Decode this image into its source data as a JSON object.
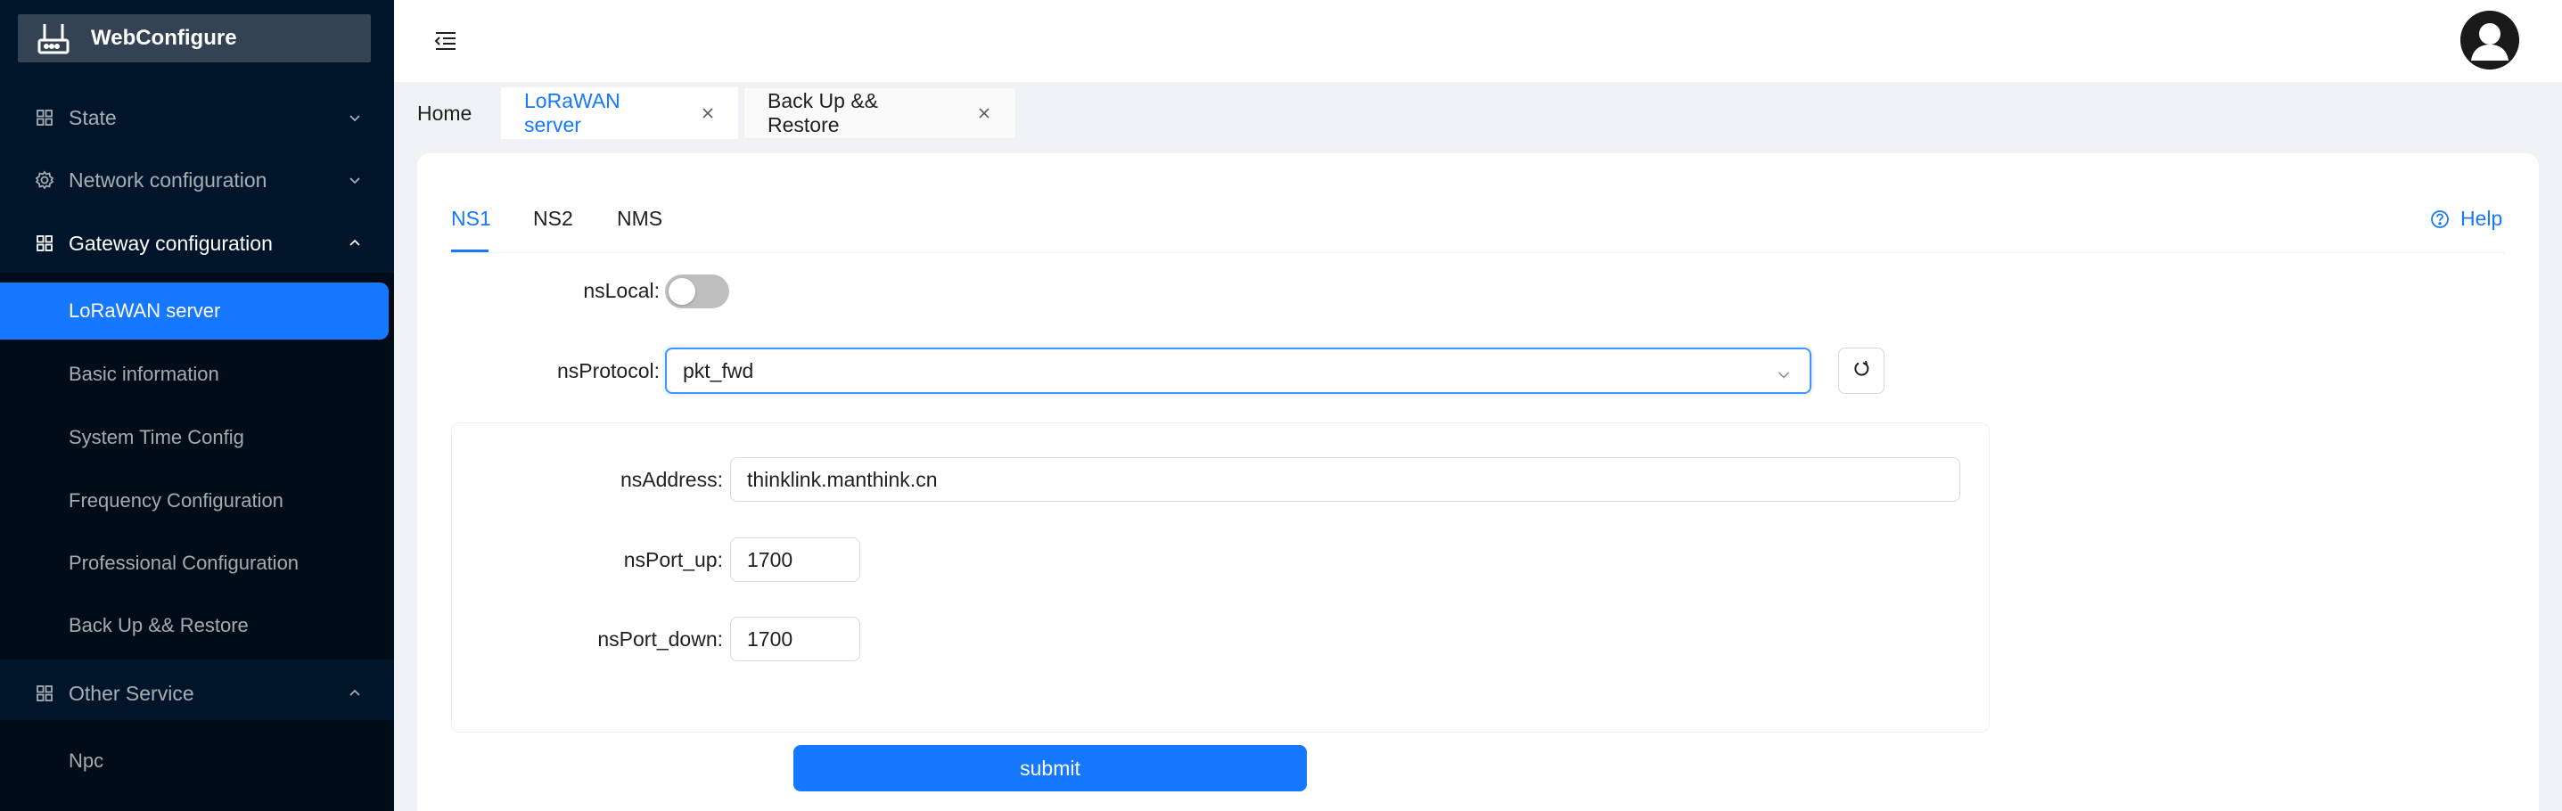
{
  "app": {
    "title": "WebConfigure"
  },
  "sidebar": {
    "menus": [
      {
        "label": "State",
        "icon": "grid-icon",
        "expanded": false
      },
      {
        "label": "Network configuration",
        "icon": "gear-icon",
        "expanded": false
      },
      {
        "label": "Gateway configuration",
        "icon": "grid-icon",
        "expanded": true
      },
      {
        "label": "Other Service",
        "icon": "grid-icon",
        "expanded": true
      }
    ],
    "gateway_items": [
      "LoRaWAN server",
      "Basic information",
      "System Time Config",
      "Frequency Configuration",
      "Professional Configuration",
      "Back Up && Restore"
    ],
    "other_items": [
      "Npc"
    ],
    "active_item": "LoRaWAN server"
  },
  "tabs": [
    {
      "label": "Home",
      "closable": false
    },
    {
      "label": "LoRaWAN server",
      "closable": true,
      "active": true
    },
    {
      "label": "Back Up && Restore",
      "closable": true
    }
  ],
  "inner_tabs": [
    "NS1",
    "NS2",
    "NMS"
  ],
  "help_label": "Help",
  "form": {
    "ns_local": {
      "label": "nsLocal",
      "value": false
    },
    "ns_protocol": {
      "label": "nsProtocol",
      "value": "pkt_fwd"
    },
    "ns_address": {
      "label": "nsAddress",
      "value": "thinklink.manthink.cn"
    },
    "ns_port_up": {
      "label": "nsPort_up",
      "value": "1700"
    },
    "ns_port_down": {
      "label": "nsPort_down",
      "value": "1700"
    },
    "submit_label": "submit"
  },
  "colors": {
    "primary": "#1677ff",
    "sidebar": "#001529",
    "submenu": "#000c17"
  }
}
